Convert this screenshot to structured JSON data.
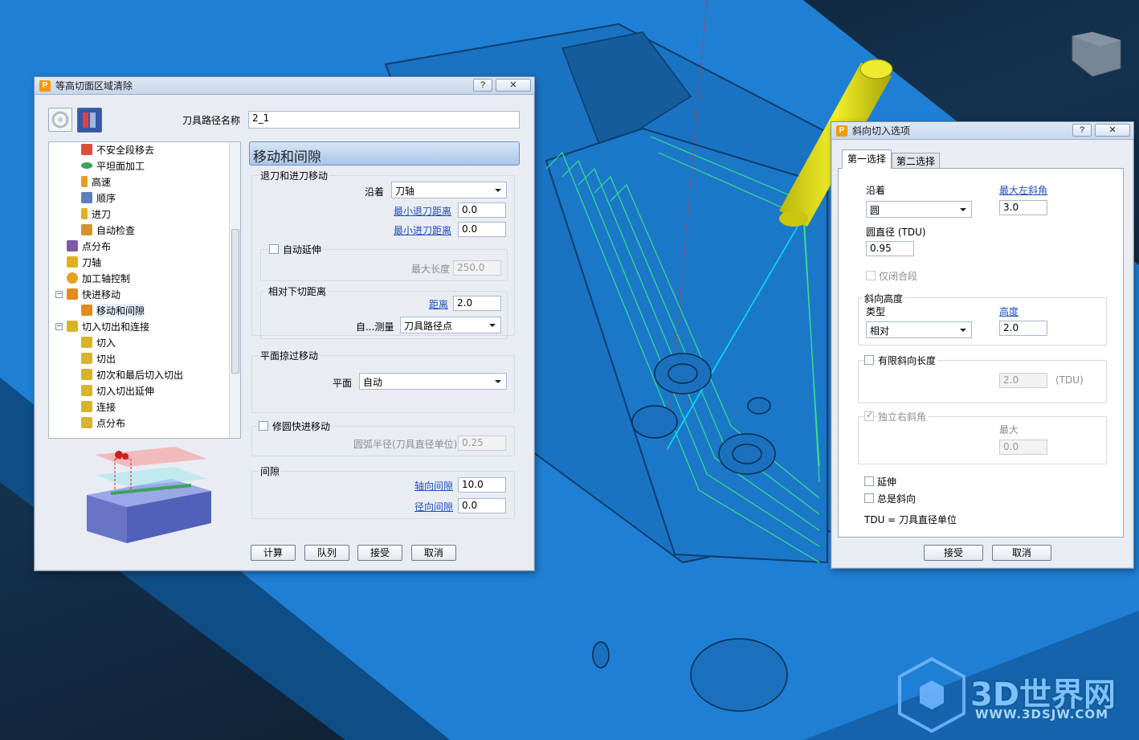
{
  "left_dialog": {
    "title": "等高切面区域清除",
    "help_btn": "?",
    "close_btn": "✕",
    "toolpath_name_label": "刀具路径名称",
    "toolpath_name_value": "2_1",
    "tree_items": [
      "不安全段移去",
      "平坦面加工",
      "高速",
      "顺序",
      "进刀",
      "自动检查",
      "点分布",
      "刀轴",
      "加工轴控制",
      "快进移动",
      "移动和间隙",
      "切入切出和连接",
      "切入",
      "切出",
      "初次和最后切入切出",
      "切入切出延伸",
      "连接",
      "点分布"
    ],
    "section_title": "移动和间隙",
    "retract_group": {
      "title": "退刀和进刀移动",
      "along_label": "沿着",
      "along_value": "刀轴",
      "min_retract_label": "最小退刀距离",
      "min_retract_value": "0.0",
      "min_approach_label": "最小进刀距离",
      "min_approach_value": "0.0",
      "auto_extend_label": "自动延伸",
      "max_length_label": "最大长度",
      "max_length_value": "250.0"
    },
    "relative_group": {
      "title": "相对下切距离",
      "distance_label": "距离",
      "distance_value": "2.0",
      "measure_label": "自...测量",
      "measure_value": "刀具路径点"
    },
    "plane_group": {
      "title": "平面掠过移动",
      "plane_label": "平面",
      "plane_value": "自动"
    },
    "round_group": {
      "title": "修圆快进移动",
      "radius_label": "圆弧半径(刀具直径单位)",
      "radius_value": "0.25"
    },
    "clearance_group": {
      "title": "间隙",
      "axial_label": "轴向间隙",
      "axial_value": "10.0",
      "radial_label": "径向间隙",
      "radial_value": "0.0"
    },
    "buttons": [
      "计算",
      "队列",
      "接受",
      "取消"
    ]
  },
  "right_dialog": {
    "title": "斜向切入选项",
    "help_btn": "?",
    "close_btn": "✕",
    "tabs": [
      "第一选择",
      "第二选择"
    ],
    "along_label": "沿着",
    "along_value": "圆",
    "max_left_angle_label": "最大左斜角",
    "max_left_angle_value": "3.0",
    "circle_diameter_label": "圆直径 (TDU)",
    "circle_diameter_value": "0.95",
    "closed_only_label": "仅闭合段",
    "ramp_height_group": {
      "title": "斜向高度",
      "type_label": "类型",
      "type_value": "相对",
      "height_label": "高度",
      "height_value": "2.0"
    },
    "finite_ramp_group": {
      "title": "有限斜向长度",
      "value": "2.0",
      "unit": "(TDU)"
    },
    "independent_right_group": {
      "title": "独立右斜角",
      "max_label": "最大",
      "max_value": "0.0"
    },
    "extend_label": "延伸",
    "always_ramp_label": "总是斜向",
    "tdu_note": "TDU = 刀具直径单位",
    "buttons": [
      "接受",
      "取消"
    ]
  },
  "watermark": {
    "brand": "3D世界网",
    "url": "WWW.3DSJW.COM"
  },
  "colors": {
    "part_blue": "#1f7fd4",
    "toolpath_green": "#37e08a",
    "tool_yellow": "#e6e21a",
    "link": "#1f4fbf"
  }
}
